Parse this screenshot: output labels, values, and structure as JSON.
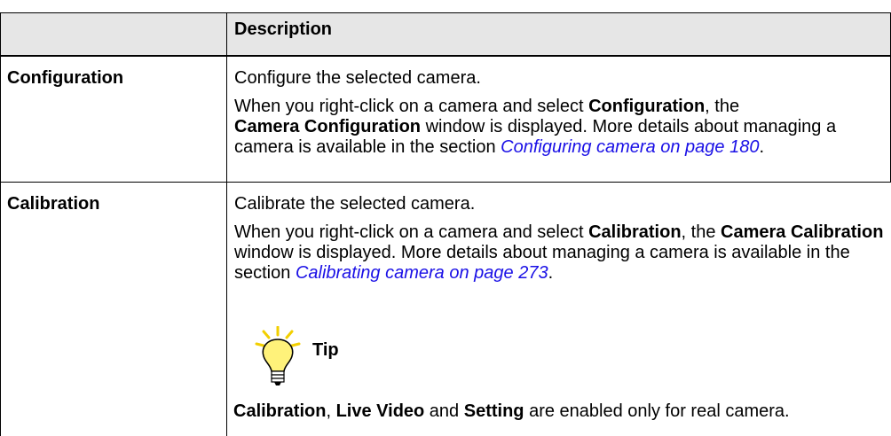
{
  "table": {
    "header": {
      "col1": "",
      "col2": "Description"
    },
    "rows": [
      {
        "name": "Configuration",
        "p1": "Configure the selected camera.",
        "p2": {
          "t1": "When you right-click on a camera and select ",
          "b1": "Configuration",
          "t2": ", the ",
          "b2": "Camera Configuration",
          "t3": " window is displayed. More details about managing a camera is available in the section ",
          "link": "Configuring camera on page 180",
          "t4": "."
        }
      },
      {
        "name": "Calibration",
        "p1": "Calibrate the selected camera.",
        "p2": {
          "t1": "When you right-click on a camera and select ",
          "b1": "Calibration",
          "t2": ", the ",
          "b2": "Camera Calibration",
          "t3": " window is displayed. More details about managing a camera is available in the section ",
          "link": "Calibrating camera on page 273",
          "t4": "."
        },
        "tip": {
          "icon": "lightbulb-icon",
          "label": "Tip",
          "b1": "Calibration",
          "t1": ", ",
          "b2": "Live Video",
          "t2": " and ",
          "b3": "Setting",
          "t3": " are enabled only for real camera."
        }
      }
    ]
  },
  "colors": {
    "header_bg": "#e6e6e6",
    "link": "#1a10e6",
    "bulb": "#fff27a",
    "rays": "#f2cf00"
  }
}
